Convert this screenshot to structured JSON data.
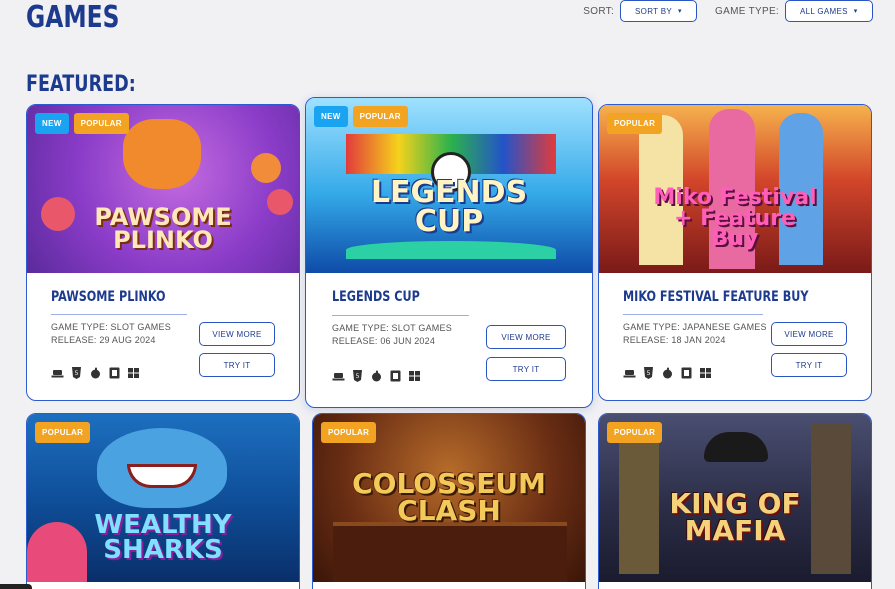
{
  "page": {
    "title": "GAMES",
    "section": "FEATURED:"
  },
  "controls": {
    "sort_label": "SORT:",
    "sort_value": "SORT BY",
    "type_label": "GAME TYPE:",
    "type_value": "ALL GAMES"
  },
  "cards": [
    {
      "name": "PAWSOME PLINKO",
      "art": "PAWSOME PLINKO",
      "badges": [
        "NEW",
        "POPULAR"
      ],
      "type": "GAME TYPE: SLOT GAMES",
      "release": "RELEASE: 29 AUG 2024",
      "view": "VIEW MORE",
      "try": "TRY IT"
    },
    {
      "name": "LEGENDS CUP",
      "art": "LEGENDS CUP",
      "badges": [
        "NEW",
        "POPULAR"
      ],
      "type": "GAME TYPE: SLOT GAMES",
      "release": "RELEASE: 06 JUN 2024",
      "view": "VIEW MORE",
      "try": "TRY IT"
    },
    {
      "name": "MIKO FESTIVAL FEATURE BUY",
      "art": "Miko Festival + Feature Buy",
      "badges": [
        "POPULAR"
      ],
      "type": "GAME TYPE: JAPANESE GAMES",
      "release": "RELEASE: 18 JAN 2024",
      "view": "VIEW MORE",
      "try": "TRY IT"
    },
    {
      "art": "WEALTHY SHARKS",
      "badges": [
        "POPULAR"
      ]
    },
    {
      "art": "COLOSSEUM CLASH",
      "badges": [
        "POPULAR"
      ]
    },
    {
      "art": "KING OF MAFIA",
      "badges": [
        "POPULAR"
      ]
    }
  ],
  "platform_icons": [
    "desktop-icon",
    "html5-icon",
    "apple-icon",
    "android-icon",
    "windows-icon"
  ],
  "colors": {
    "accent": "#2c5bd0",
    "title": "#1d3b8e",
    "badge_new": "#1aa3f0",
    "badge_popular": "#f1a321"
  }
}
